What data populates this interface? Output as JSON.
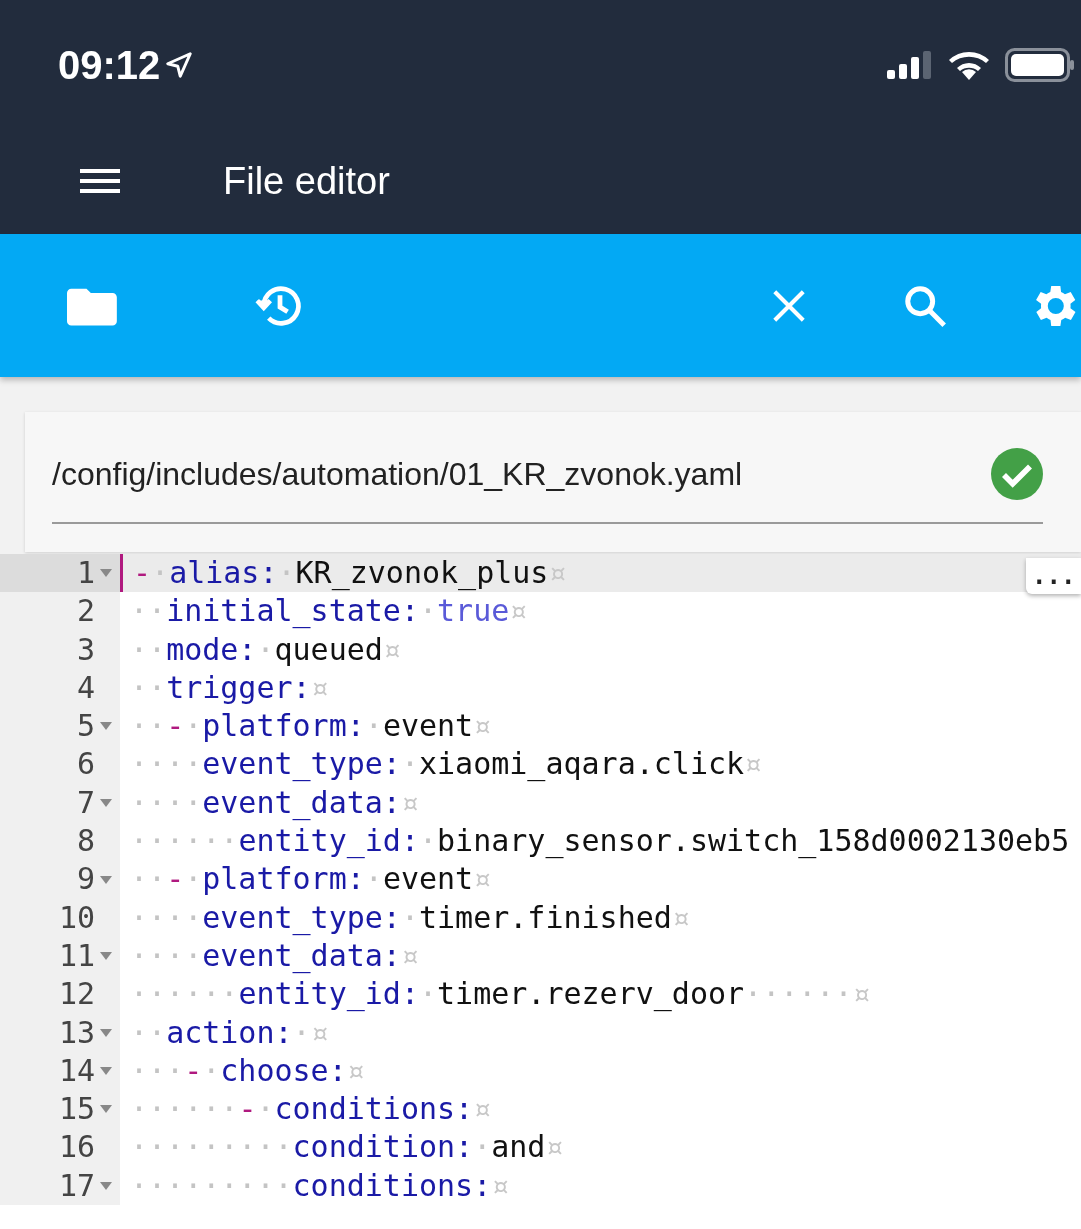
{
  "status_bar": {
    "time": "09:12"
  },
  "app_bar": {
    "title": "File editor"
  },
  "file": {
    "path": "/config/includes/automation/01_KR_zvonok.yaml",
    "valid": true
  },
  "editor": {
    "overflow_button": "...",
    "lines": [
      {
        "number": "1",
        "foldable": true,
        "active": true,
        "tokens": [
          {
            "kind": "dash",
            "text": "-"
          },
          {
            "kind": "ws",
            "text": "·"
          },
          {
            "kind": "key",
            "text": "alias:"
          },
          {
            "kind": "ws",
            "text": "·"
          },
          {
            "kind": "str",
            "text": "KR_zvonok_plus"
          },
          {
            "kind": "eol",
            "text": "¤"
          }
        ]
      },
      {
        "number": "2",
        "foldable": false,
        "active": false,
        "tokens": [
          {
            "kind": "ws",
            "text": "··"
          },
          {
            "kind": "key",
            "text": "initial_state:"
          },
          {
            "kind": "ws",
            "text": "·"
          },
          {
            "kind": "bool",
            "text": "true"
          },
          {
            "kind": "eol",
            "text": "¤"
          }
        ]
      },
      {
        "number": "3",
        "foldable": false,
        "active": false,
        "tokens": [
          {
            "kind": "ws",
            "text": "··"
          },
          {
            "kind": "key",
            "text": "mode:"
          },
          {
            "kind": "ws",
            "text": "·"
          },
          {
            "kind": "str",
            "text": "queued"
          },
          {
            "kind": "eol",
            "text": "¤"
          }
        ]
      },
      {
        "number": "4",
        "foldable": false,
        "active": false,
        "tokens": [
          {
            "kind": "ws",
            "text": "··"
          },
          {
            "kind": "key",
            "text": "trigger:"
          },
          {
            "kind": "eol",
            "text": "¤"
          }
        ]
      },
      {
        "number": "5",
        "foldable": true,
        "active": false,
        "tokens": [
          {
            "kind": "ws",
            "text": "··"
          },
          {
            "kind": "dash",
            "text": "-"
          },
          {
            "kind": "ws",
            "text": "·"
          },
          {
            "kind": "key",
            "text": "platform:"
          },
          {
            "kind": "ws",
            "text": "·"
          },
          {
            "kind": "str",
            "text": "event"
          },
          {
            "kind": "eol",
            "text": "¤"
          }
        ]
      },
      {
        "number": "6",
        "foldable": false,
        "active": false,
        "tokens": [
          {
            "kind": "ws",
            "text": "····"
          },
          {
            "kind": "key",
            "text": "event_type:"
          },
          {
            "kind": "ws",
            "text": "·"
          },
          {
            "kind": "str",
            "text": "xiaomi_aqara.click"
          },
          {
            "kind": "eol",
            "text": "¤"
          }
        ]
      },
      {
        "number": "7",
        "foldable": true,
        "active": false,
        "tokens": [
          {
            "kind": "ws",
            "text": "····"
          },
          {
            "kind": "key",
            "text": "event_data:"
          },
          {
            "kind": "eol",
            "text": "¤"
          }
        ]
      },
      {
        "number": "8",
        "foldable": false,
        "active": false,
        "tokens": [
          {
            "kind": "ws",
            "text": "······"
          },
          {
            "kind": "key",
            "text": "entity_id:"
          },
          {
            "kind": "ws",
            "text": "·"
          },
          {
            "kind": "str",
            "text": "binary_sensor.switch_158d0002130eb5"
          }
        ]
      },
      {
        "number": "9",
        "foldable": true,
        "active": false,
        "tokens": [
          {
            "kind": "ws",
            "text": "··"
          },
          {
            "kind": "dash",
            "text": "-"
          },
          {
            "kind": "ws",
            "text": "·"
          },
          {
            "kind": "key",
            "text": "platform:"
          },
          {
            "kind": "ws",
            "text": "·"
          },
          {
            "kind": "str",
            "text": "event"
          },
          {
            "kind": "eol",
            "text": "¤"
          }
        ]
      },
      {
        "number": "10",
        "foldable": false,
        "active": false,
        "tokens": [
          {
            "kind": "ws",
            "text": "····"
          },
          {
            "kind": "key",
            "text": "event_type:"
          },
          {
            "kind": "ws",
            "text": "·"
          },
          {
            "kind": "str",
            "text": "timer.finished"
          },
          {
            "kind": "eol",
            "text": "¤"
          }
        ]
      },
      {
        "number": "11",
        "foldable": true,
        "active": false,
        "tokens": [
          {
            "kind": "ws",
            "text": "····"
          },
          {
            "kind": "key",
            "text": "event_data:"
          },
          {
            "kind": "eol",
            "text": "¤"
          }
        ]
      },
      {
        "number": "12",
        "foldable": false,
        "active": false,
        "tokens": [
          {
            "kind": "ws",
            "text": "······"
          },
          {
            "kind": "key",
            "text": "entity_id:"
          },
          {
            "kind": "ws",
            "text": "·"
          },
          {
            "kind": "str",
            "text": "timer.rezerv_door"
          },
          {
            "kind": "ws",
            "text": "······"
          },
          {
            "kind": "eol",
            "text": "¤"
          }
        ]
      },
      {
        "number": "13",
        "foldable": true,
        "active": false,
        "tokens": [
          {
            "kind": "ws",
            "text": "··"
          },
          {
            "kind": "key",
            "text": "action:"
          },
          {
            "kind": "ws",
            "text": "·"
          },
          {
            "kind": "eol",
            "text": "¤"
          }
        ]
      },
      {
        "number": "14",
        "foldable": true,
        "active": false,
        "tokens": [
          {
            "kind": "ws",
            "text": "···"
          },
          {
            "kind": "dash",
            "text": "-"
          },
          {
            "kind": "ws",
            "text": "·"
          },
          {
            "kind": "key",
            "text": "choose:"
          },
          {
            "kind": "eol",
            "text": "¤"
          }
        ]
      },
      {
        "number": "15",
        "foldable": true,
        "active": false,
        "tokens": [
          {
            "kind": "ws",
            "text": "······"
          },
          {
            "kind": "dash",
            "text": "-"
          },
          {
            "kind": "ws",
            "text": "·"
          },
          {
            "kind": "key",
            "text": "conditions:"
          },
          {
            "kind": "eol",
            "text": "¤"
          }
        ]
      },
      {
        "number": "16",
        "foldable": false,
        "active": false,
        "tokens": [
          {
            "kind": "ws",
            "text": "·········"
          },
          {
            "kind": "key",
            "text": "condition:"
          },
          {
            "kind": "ws",
            "text": "·"
          },
          {
            "kind": "str",
            "text": "and"
          },
          {
            "kind": "eol",
            "text": "¤"
          }
        ]
      },
      {
        "number": "17",
        "foldable": true,
        "active": false,
        "tokens": [
          {
            "kind": "ws",
            "text": "·········"
          },
          {
            "kind": "key",
            "text": "conditions:"
          },
          {
            "kind": "eol",
            "text": "¤"
          }
        ]
      }
    ]
  }
}
